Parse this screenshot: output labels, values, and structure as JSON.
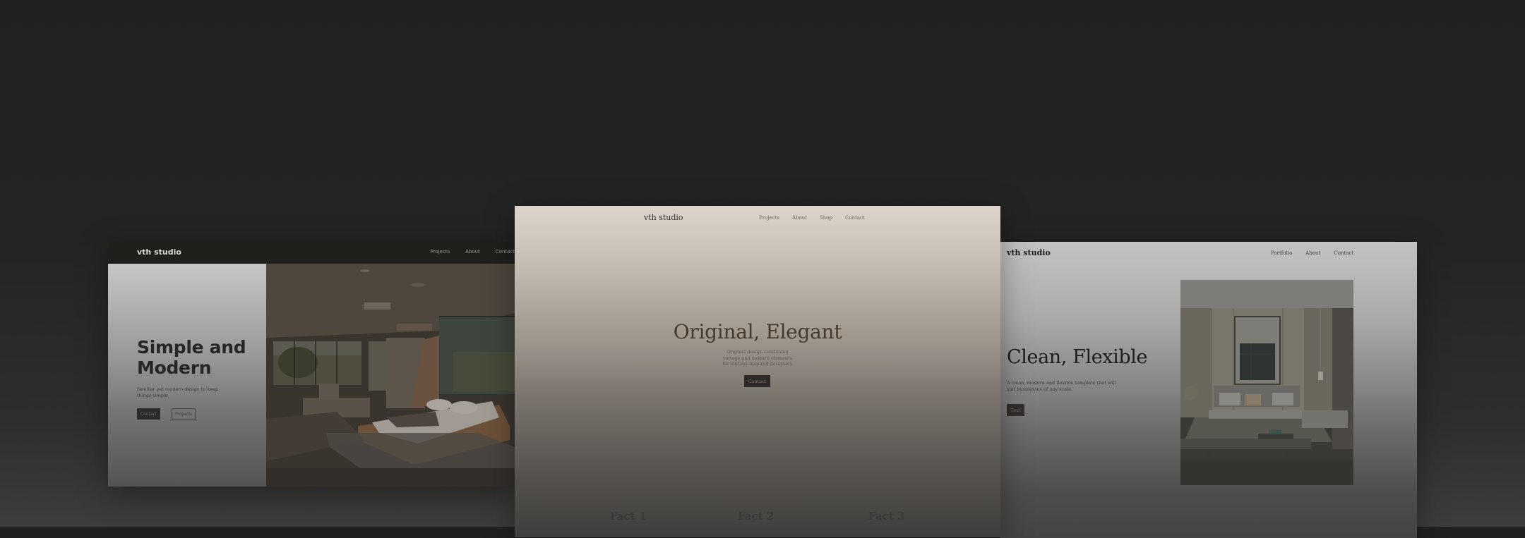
{
  "templates": [
    {
      "id": "left",
      "logo": "vth studio",
      "nav": [
        "Projects",
        "About",
        "Contact"
      ],
      "hero_title_line1": "Simple and",
      "hero_title_line2": "Modern",
      "hero_sub": "Familiar yet modern design to keep things simple",
      "buttons": {
        "primary": "Contact",
        "secondary": "Projects"
      },
      "image": "modern-desert-bedroom-photo"
    },
    {
      "id": "center",
      "logo": "vth studio",
      "nav": [
        "Projects",
        "About",
        "Shop",
        "Contact"
      ],
      "hero_title": "Original, Elegant",
      "hero_sub_lines": [
        "Original design combining",
        "vintage and modern elements",
        "for vintage-inspired designers"
      ],
      "buttons": {
        "primary": "Contact"
      },
      "facts": [
        "Fact 1",
        "Fact 2",
        "Fact 3"
      ]
    },
    {
      "id": "right",
      "logo": "vth studio",
      "nav": [
        "Portfolio",
        "About",
        "Contact"
      ],
      "hero_title": "Clean, Flexible",
      "hero_sub": "A clean, modern and flexible template that will suit businesses of any scale.",
      "buttons": {
        "primary": "Text"
      },
      "image": "luxury-bedroom-photo"
    }
  ],
  "colors": {
    "background": "#222222",
    "left_nav": "#1f1f1c",
    "center_accent": "#45392c",
    "button_dark": "#2e2a27"
  }
}
